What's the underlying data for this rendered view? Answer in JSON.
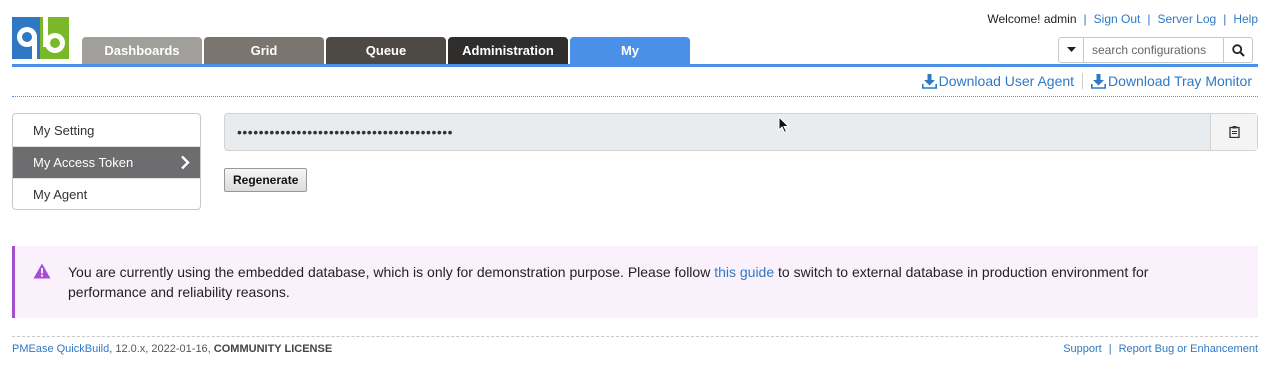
{
  "header": {
    "welcome": "Welcome! admin",
    "links": [
      "Sign Out",
      "Server Log",
      "Help"
    ],
    "search_placeholder": "search configurations"
  },
  "tabs": [
    {
      "label": "Dashboards",
      "color": "#a09f9b"
    },
    {
      "label": "Grid",
      "color": "#7b756f"
    },
    {
      "label": "Queue",
      "color": "#4d4a46"
    },
    {
      "label": "Administration",
      "color": "#2f2e2d"
    },
    {
      "label": "My",
      "color": "#4a90e8",
      "active": true
    }
  ],
  "downloads": {
    "user_agent": "Download User Agent",
    "tray_monitor": "Download Tray Monitor"
  },
  "menu": {
    "items": [
      {
        "label": "My Setting"
      },
      {
        "label": "My Access Token",
        "active": true
      },
      {
        "label": "My Agent"
      }
    ]
  },
  "token": {
    "masked_value": "••••••••••••••••••••••••••••••••••••••••",
    "copy_icon": "clipboard-icon",
    "regenerate_label": "Regenerate"
  },
  "warning": {
    "icon": "warning-triangle-icon",
    "text_before": "You are currently using the embedded database, which is only for demonstration purpose. Please follow ",
    "link": "this guide",
    "text_after": " to switch to external database in production environment for performance and reliability reasons."
  },
  "footer": {
    "product_link": "PMEase QuickBuild",
    "version_info": ", 12.0.x, 2022-01-16, ",
    "license": "COMMUNITY LICENSE",
    "support": "Support",
    "report": "Report Bug or Enhancement"
  },
  "colors": {
    "accent": "#4a90e8",
    "link": "#2f79c4",
    "warning_border": "#a54ed3",
    "warning_bg": "#fbf1fd"
  }
}
